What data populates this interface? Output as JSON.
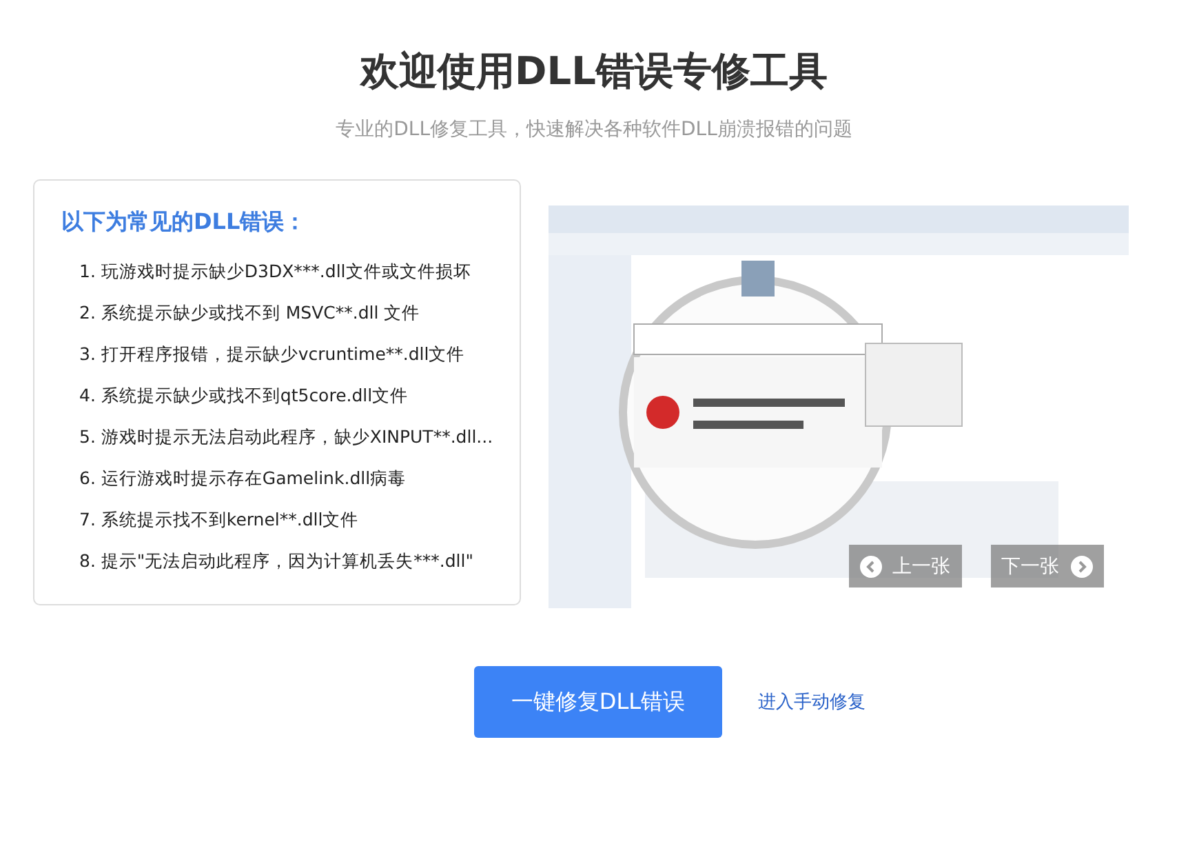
{
  "title": "欢迎使用DLL错误专修工具",
  "subtitle": "专业的DLL修复工具，快速解决各种软件DLL崩溃报错的问题",
  "errors_card": {
    "heading": "以下为常见的DLL错误：",
    "items": [
      "1. 玩游戏时提示缺少D3DX***.dll文件或文件损坏",
      "2. 系统提示缺少或找不到 MSVC**.dll 文件",
      "3. 打开程序报错，提示缺少vcruntime**.dll文件",
      "4. 系统提示缺少或找不到qt5core.dll文件",
      "5. 游戏时提示无法启动此程序，缺少XINPUT**.dll...",
      "6. 运行游戏时提示存在Gamelink.dll病毒",
      "7. 系统提示找不到kernel**.dll文件",
      "8. 提示\"无法启动此程序，因为计算机丢失***.dll\""
    ]
  },
  "carousel": {
    "kind": "picture",
    "prev_button": "上一张",
    "next_button": "下一张"
  },
  "actions": {
    "primary_button": "一键修复DLL错误",
    "manual_link": "进入手动修复"
  }
}
